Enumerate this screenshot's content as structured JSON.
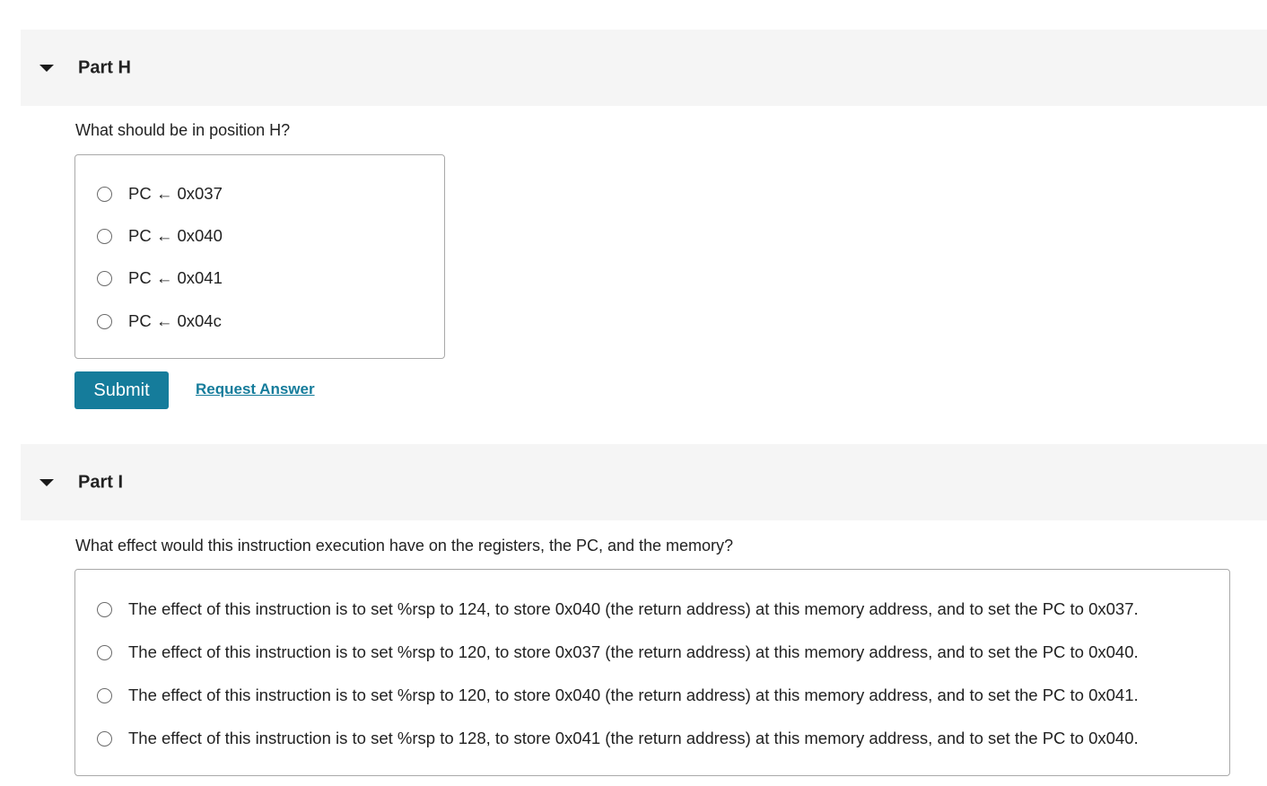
{
  "partH": {
    "title": "Part H",
    "question": "What should be in position H?",
    "choices": [
      "PC ← 0x037",
      "PC ← 0x040",
      "PC ← 0x041",
      "PC ← 0x04c"
    ],
    "submit_label": "Submit",
    "request_answer_label": "Request Answer"
  },
  "partI": {
    "title": "Part I",
    "question": "What effect would this instruction execution have on the registers, the PC, and the memory?",
    "choices": [
      "The effect of this instruction is to set %rsp to 124, to store 0x040 (the return address) at this memory address, and to set the PC to 0x037.",
      "The effect of this instruction is to set %rsp to 120, to store 0x037 (the return address) at this memory address, and to set the PC to 0x040.",
      "The effect of this instruction is to set %rsp to 120, to store 0x040 (the return address) at this memory address, and to set the PC to 0x041.",
      "The effect of this instruction is to set %rsp to 128, to store 0x041 (the return address) at this memory address, and to set the PC to 0x040."
    ]
  },
  "icons": {
    "collapse": "caret-down-icon",
    "radio": "radio-unchecked"
  },
  "colors": {
    "accent": "#157c9b",
    "header_bg": "#f5f5f5",
    "border": "#a9a9a9"
  }
}
